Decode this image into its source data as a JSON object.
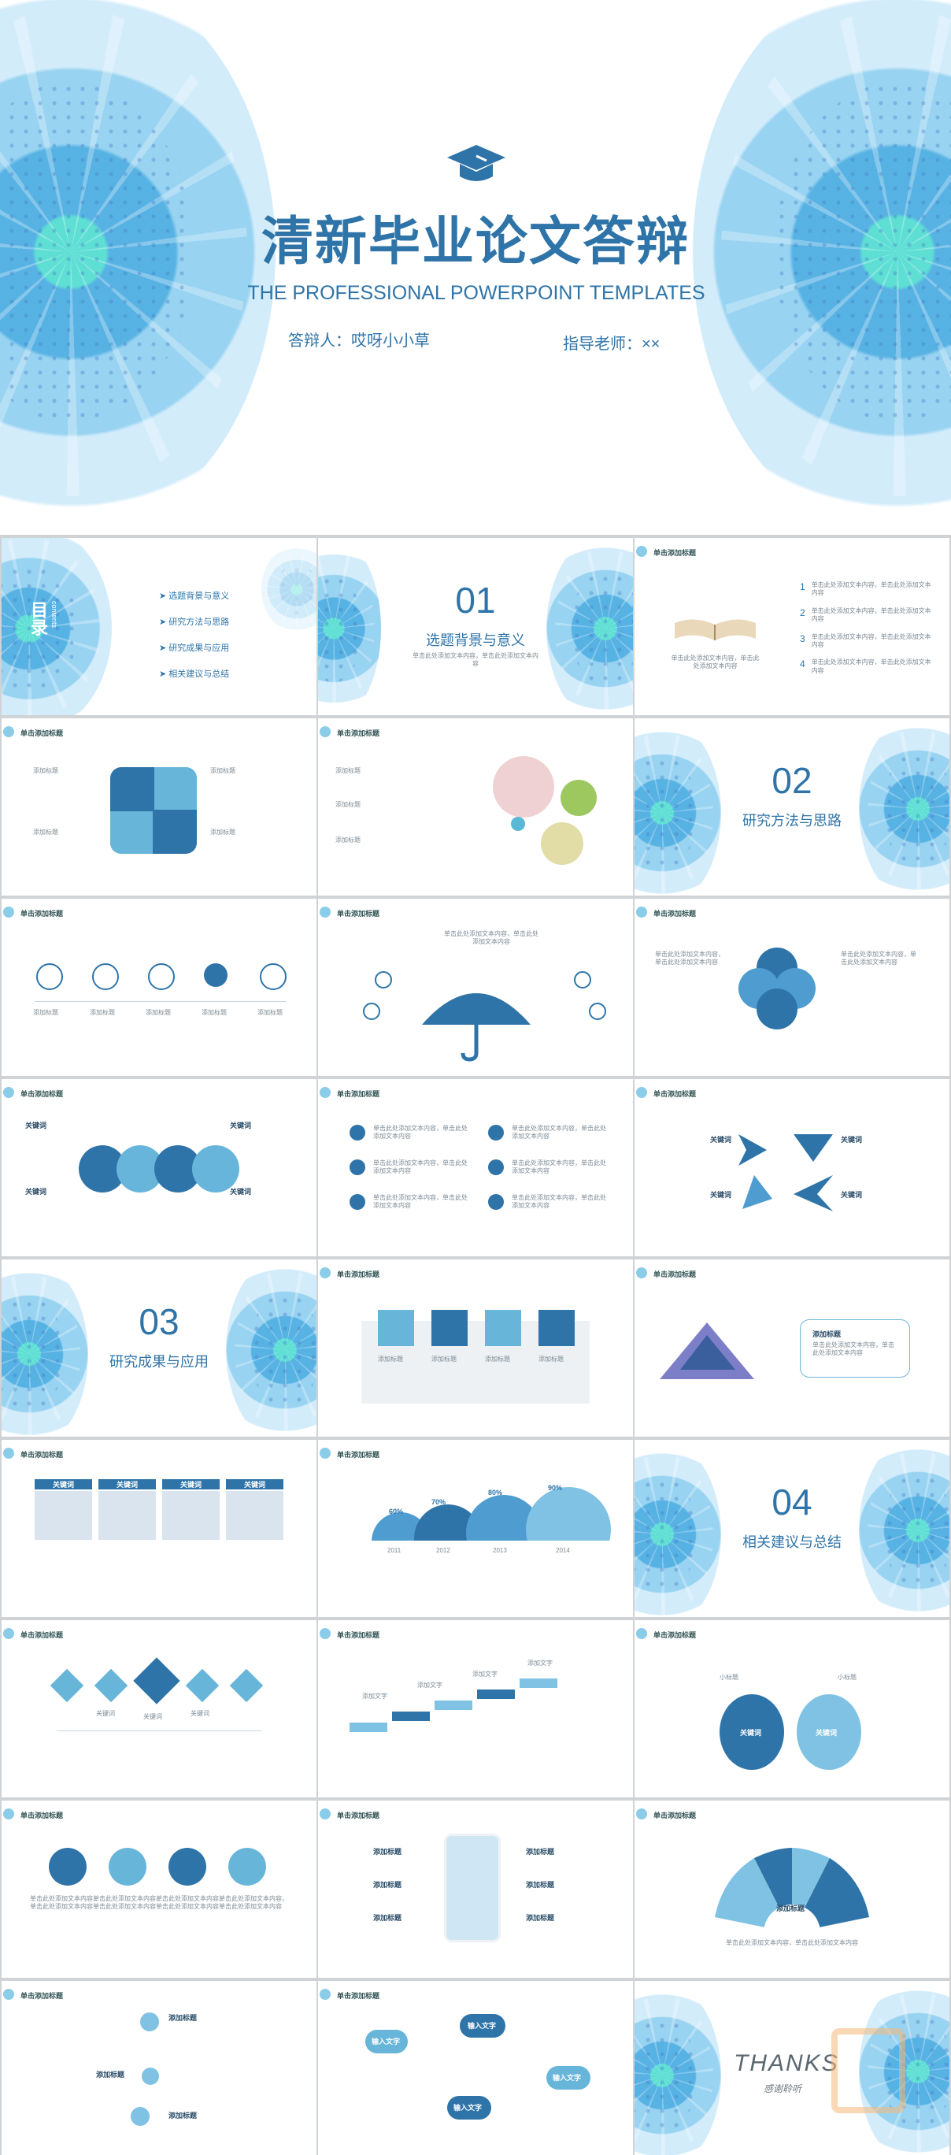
{
  "cover": {
    "title": "清新毕业论文答辩",
    "subtitle": "THE PROFESSIONAL POWERPOINT TEMPLATES",
    "presenter": "答辩人：哎呀小小草",
    "advisor": "指导老师：××"
  },
  "common": {
    "slide_tag": "单击添加标题",
    "placeholder_text": "单击此处添加文本内容，单击此处添加文本内容",
    "label_keyword": "关键词",
    "label_title": "添加标题",
    "label_input": "输入文字",
    "label_small_title": "小标题",
    "label_fill": "添加文字"
  },
  "toc": {
    "title": "目录",
    "subtitle": "contents",
    "items": [
      "选题背景与意义",
      "研究方法与思路",
      "研究成果与应用",
      "相关建议与总结"
    ]
  },
  "sections": {
    "s1": {
      "number": "01",
      "title": "选题背景与意义"
    },
    "s2": {
      "number": "02",
      "title": "研究方法与思路"
    },
    "s3": {
      "number": "03",
      "title": "研究成果与应用"
    },
    "s4": {
      "number": "04",
      "title": "相关建议与总结"
    }
  },
  "book_list": {
    "items": [
      "1",
      "2",
      "3",
      "4"
    ]
  },
  "arch_chart": {
    "years": [
      "2011",
      "2012",
      "2013",
      "2014"
    ],
    "percents": [
      "60%",
      "70%",
      "80%",
      "90%"
    ]
  },
  "thanks": {
    "word": "THANKS",
    "cn": "感谢聆听"
  },
  "colors": {
    "primary": "#2f74a8",
    "light": "#6db8df",
    "accent": "#57c3dd"
  }
}
